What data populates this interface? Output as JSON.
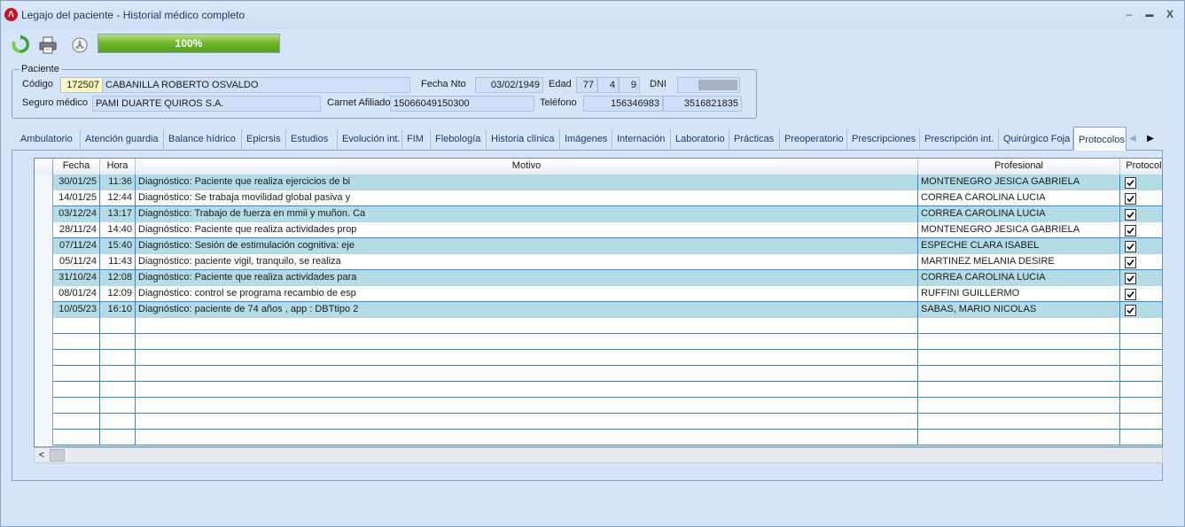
{
  "window": {
    "title": "Legajo del paciente - Historial médico completo",
    "app_icon_glyph": "Λ",
    "minimize_glyph": "–",
    "maximize_glyph": "▬",
    "close_glyph": "X"
  },
  "toolbar": {
    "icons": [
      "refresh-icon",
      "print-icon",
      "stop-icon"
    ],
    "progress_value": 1.0,
    "progress_text": "100%",
    "progress_color": "#6cb52b"
  },
  "patient": {
    "legend": "Paciente",
    "codigo_label": "Código",
    "codigo": "172507",
    "nombre": "CABANILLA ROBERTO OSVALDO",
    "fecha_nto_label": "Fecha Nto",
    "fecha_nto": "03/02/1949",
    "edad_label": "Edad",
    "edad_anios": "77",
    "edad_meses": "4",
    "edad_dias": "9",
    "dni_label": "DNI",
    "dni": "",
    "seguro_label": "Seguro médico",
    "seguro": "PAMI DUARTE QUIROS S.A.",
    "carnet_label": "Carnet Afiliado",
    "carnet": "15066049150300",
    "telefono_label": "Teléfono",
    "telefono1": "156346983",
    "telefono2": "3516821835"
  },
  "tabs": [
    "Ambulatorio",
    "Atención guardia",
    "Balance hídrico",
    "Epicrsis",
    "Estudios",
    "Evolución int.",
    "FIM",
    "Flebología",
    "Historia clínica",
    "Imágenes",
    "Internación",
    "Laboratorio",
    "Prácticas",
    "Preoperatorio",
    "Prescripciones",
    "Prescripción int.",
    "Quirúrgico Foja",
    "Protocolos"
  ],
  "active_tab": "Protocolos",
  "grid": {
    "columns": [
      "Fecha",
      "Hora",
      "Motivo",
      "Profesional",
      "Protocolo"
    ],
    "rows": [
      {
        "fecha": "30/01/25",
        "hora": "11:36",
        "motivo": "Diagnóstico: Paciente que realiza ejercicios de bi",
        "profesional": "MONTENEGRO JESICA GABRIELA",
        "protocolo": true
      },
      {
        "fecha": "14/01/25",
        "hora": "12:44",
        "motivo": "Diagnóstico: Se trabaja movilidad global pasiva y",
        "profesional": "CORREA CAROLINA LUCIA",
        "protocolo": true
      },
      {
        "fecha": "03/12/24",
        "hora": "13:17",
        "motivo": "Diagnóstico: Trabajo de fuerza en mmii y muñon. Ca",
        "profesional": "CORREA CAROLINA LUCIA",
        "protocolo": true
      },
      {
        "fecha": "28/11/24",
        "hora": "14:40",
        "motivo": "Diagnóstico: Paciente que realiza actividades prop",
        "profesional": "MONTENEGRO JESICA GABRIELA",
        "protocolo": true
      },
      {
        "fecha": "07/11/24",
        "hora": "15:40",
        "motivo": "Diagnóstico: Sesión de estimulación cognitiva: eje",
        "profesional": "ESPECHE CLARA ISABEL",
        "protocolo": true
      },
      {
        "fecha": "05/11/24",
        "hora": "11:43",
        "motivo": "Diagnóstico: paciente vigil, tranquilo, se realiza",
        "profesional": "MARTINEZ MELANIA DESIRE",
        "protocolo": true
      },
      {
        "fecha": "31/10/24",
        "hora": "12:08",
        "motivo": "Diagnóstico: Paciente que realiza actividades para",
        "profesional": "CORREA CAROLINA LUCIA",
        "protocolo": true
      },
      {
        "fecha": "08/01/24",
        "hora": "12:09",
        "motivo": "Diagnóstico: control se programa recambio de esp",
        "profesional": "RUFFINI GUILLERMO",
        "protocolo": true
      },
      {
        "fecha": "10/05/23",
        "hora": "16:10",
        "motivo": "Diagnóstico: paciente de 74 años , app : DBTtipo 2",
        "profesional": "SABAS, MARIO NICOLAS",
        "protocolo": true
      }
    ],
    "row_shade_color": "#b4dce6",
    "grid_line_color": "#3a86d6"
  },
  "scroll": {
    "left_arrow_glyph": "<",
    "tab_left_glyph": "◀",
    "tab_right_glyph": "▶"
  }
}
